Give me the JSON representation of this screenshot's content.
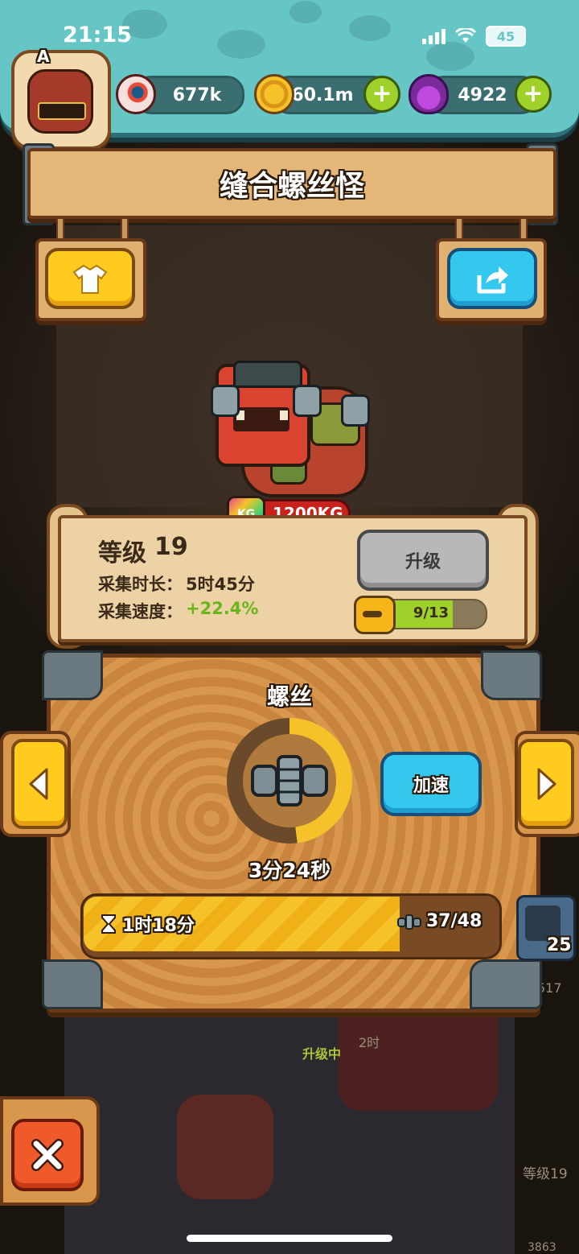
{
  "status_bar": {
    "time": "21:15",
    "battery": "45"
  },
  "currencies": {
    "eyes": {
      "value": "677k",
      "icon": "eyeball-icon"
    },
    "coins": {
      "value": "60.1m",
      "icon": "coin-icon"
    },
    "potions": {
      "value": "4922",
      "icon": "potion-icon"
    }
  },
  "avatar": {
    "badge": "A"
  },
  "monster": {
    "name": "缝合螺丝怪",
    "weight": "1200KG",
    "weight_icon_label": "KG"
  },
  "stats": {
    "level_label": "等级",
    "level": "19",
    "duration_label": "采集时长：",
    "duration_value": "5时45分",
    "speed_label": "采集速度：",
    "speed_value": "+22.4%",
    "upgrade_label": "升级",
    "xp_text": "9/13",
    "xp_fraction": 0.69
  },
  "production": {
    "item_name": "螺丝",
    "timer": "3分24秒",
    "cycle_fraction": 0.48,
    "speedup_label": "加速",
    "remaining_time": "1时18分",
    "count_text": "37/48",
    "progress_fraction": 0.77
  },
  "side_card": {
    "count": "25"
  },
  "background": {
    "side_number": "517",
    "upgrading_label": "升级中",
    "lower_time": "2时",
    "lower_level": "等级19",
    "lower_count": "3863"
  },
  "colors": {
    "accent_yellow": "#ffcb1f",
    "accent_blue": "#35c8ef",
    "speed_green": "#9ed12a",
    "weight_red": "#c9211b"
  }
}
